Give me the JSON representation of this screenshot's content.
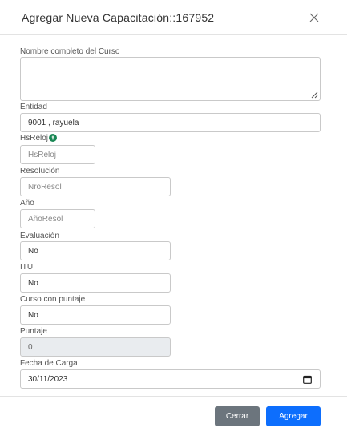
{
  "modal": {
    "title": "Agregar Nueva Capacitación::167952"
  },
  "form": {
    "course_name": {
      "label": "Nombre completo del Curso",
      "value": ""
    },
    "entity": {
      "label": "Entidad",
      "value": "9001 , rayuela"
    },
    "hours": {
      "label": "HsReloj",
      "placeholder": "HsReloj",
      "value": ""
    },
    "resolution": {
      "label": "Resolución",
      "placeholder": "NroResol",
      "value": ""
    },
    "year": {
      "label": "Año",
      "placeholder": "AñoResol",
      "value": ""
    },
    "evaluation": {
      "label": "Evaluación",
      "value": "No"
    },
    "itu": {
      "label": "ITU",
      "value": "No"
    },
    "scored_course": {
      "label": "Curso con puntaje",
      "value": "No"
    },
    "score": {
      "label": "Puntaje",
      "value": "0"
    },
    "load_date": {
      "label": "Fecha de Carga",
      "value": "30/11/2023"
    }
  },
  "footer": {
    "close_label": "Cerrar",
    "add_label": "Agregar"
  },
  "colors": {
    "primary": "#0d6efd",
    "secondary": "#6c757d",
    "info_icon": "#198754",
    "disabled_bg": "#e9ecef"
  },
  "icons": [
    "close-icon",
    "info-icon",
    "calendar-icon",
    "resize-grip-icon"
  ]
}
